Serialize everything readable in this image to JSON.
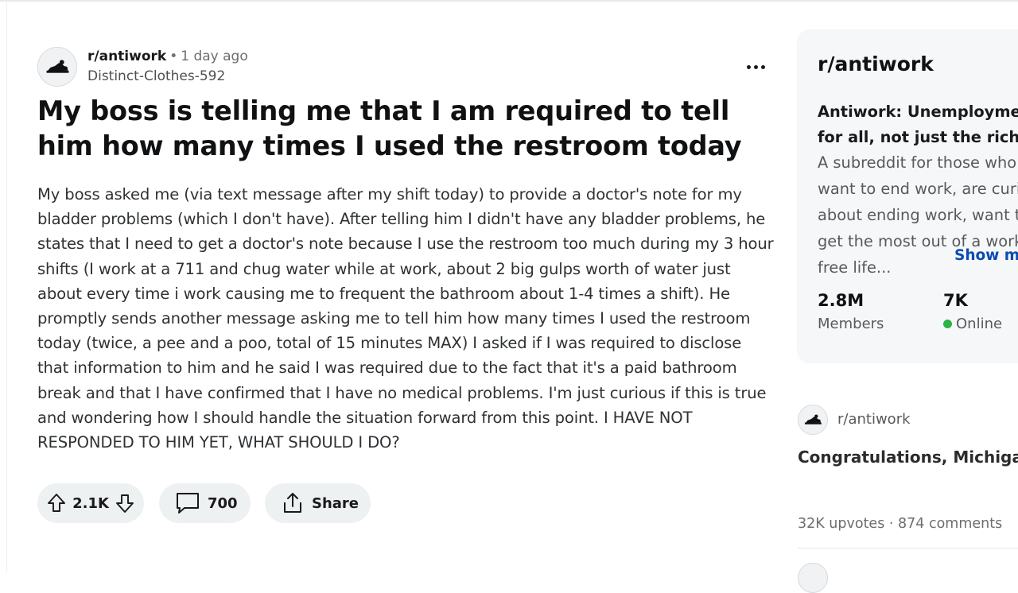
{
  "post": {
    "subreddit": "r/antiwork",
    "separator": "•",
    "time": "1 day ago",
    "author": "Distinct-Clothes-592",
    "title": "My boss is telling me that I am required to tell him how many times I used the restroom today",
    "body": "My boss asked me (via text message after my shift today) to provide a doctor's note for my bladder problems (which I don't have). After telling him I didn't have any bladder problems, he states that I need to get a doctor's note because I use the restroom too much during my 3 hour shifts (I work at a 711 and chug water while at work, about 2 big gulps worth of water just about every time i work causing me to frequent the bathroom about 1-4 times a shift). He promptly sends another message asking me to tell him how many times I used the restroom today (twice, a pee and a poo, total of 15 minutes MAX) I asked if I was required to disclose that information to him and he said I was required due to the fact that it's a paid bathroom break and that I have confirmed that I have no medical problems. I'm just curious if this is true and wondering how I should handle the situation forward from this point. I HAVE NOT RESPONDED TO HIM YET, WHAT SHOULD I DO?",
    "more_icon": "more-horizontal-icon"
  },
  "actions": {
    "votes": "2.1K",
    "comments": "700",
    "share_label": "Share",
    "upvote_icon": "upvote-arrow-icon",
    "downvote_icon": "downvote-arrow-icon",
    "comment_icon": "comment-bubble-icon",
    "share_icon": "share-upload-icon"
  },
  "sidebar": {
    "name": "r/antiwork",
    "tagline": "Antiwork: Unemployment for all, not just the rich!",
    "description": "A subreddit for those who want to end work, are curious about ending work, want to get the most out of a work-free life...",
    "show_more": "Show more",
    "members_count": "2.8M",
    "members_label": "Members",
    "online_count": "7K",
    "online_label": "Online",
    "online_color": "#2cb34a"
  },
  "related": {
    "subreddit": "r/antiwork",
    "title": "Congratulations, Michigan!",
    "stats": "32K upvotes  ·  874 comments"
  }
}
